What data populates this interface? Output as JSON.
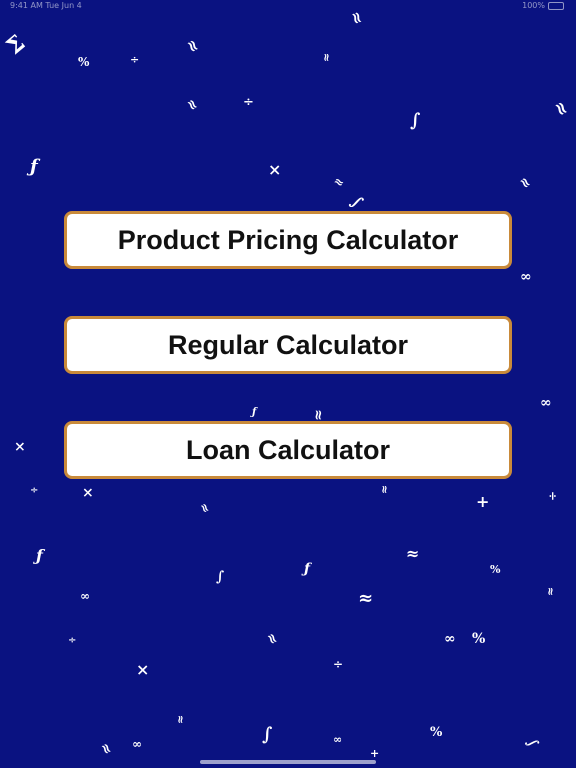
{
  "status_bar": {
    "left_text": "9:41 AM  Tue Jun 4",
    "right_text": "100%"
  },
  "buttons": [
    {
      "label": "Product Pricing Calculator"
    },
    {
      "label": "Regular Calculator"
    },
    {
      "label": "Loan Calculator"
    }
  ],
  "background": {
    "color": "#0a1281",
    "symbols": [
      "Σ",
      "%",
      "≈",
      "÷",
      "≈",
      "≈",
      "÷",
      "∫",
      "≈",
      "ƒ",
      "×",
      "≈",
      "≈",
      "∫",
      "≈",
      "∞",
      "×",
      "÷",
      "ƒ",
      "≈",
      "≈",
      "×",
      "÷",
      "≈",
      "≈",
      "+",
      "÷",
      "ƒ",
      "∫",
      "ƒ",
      "≈",
      "∞",
      "%",
      "≈",
      "∞",
      "≈",
      "%",
      "÷",
      "∞",
      "×",
      "≈",
      "∞",
      "∫",
      "≈",
      "∞",
      "+",
      "%",
      "∫"
    ]
  },
  "colors": {
    "button_bg": "#ffffff",
    "button_border": "#c98a3a",
    "button_text": "#111111"
  }
}
